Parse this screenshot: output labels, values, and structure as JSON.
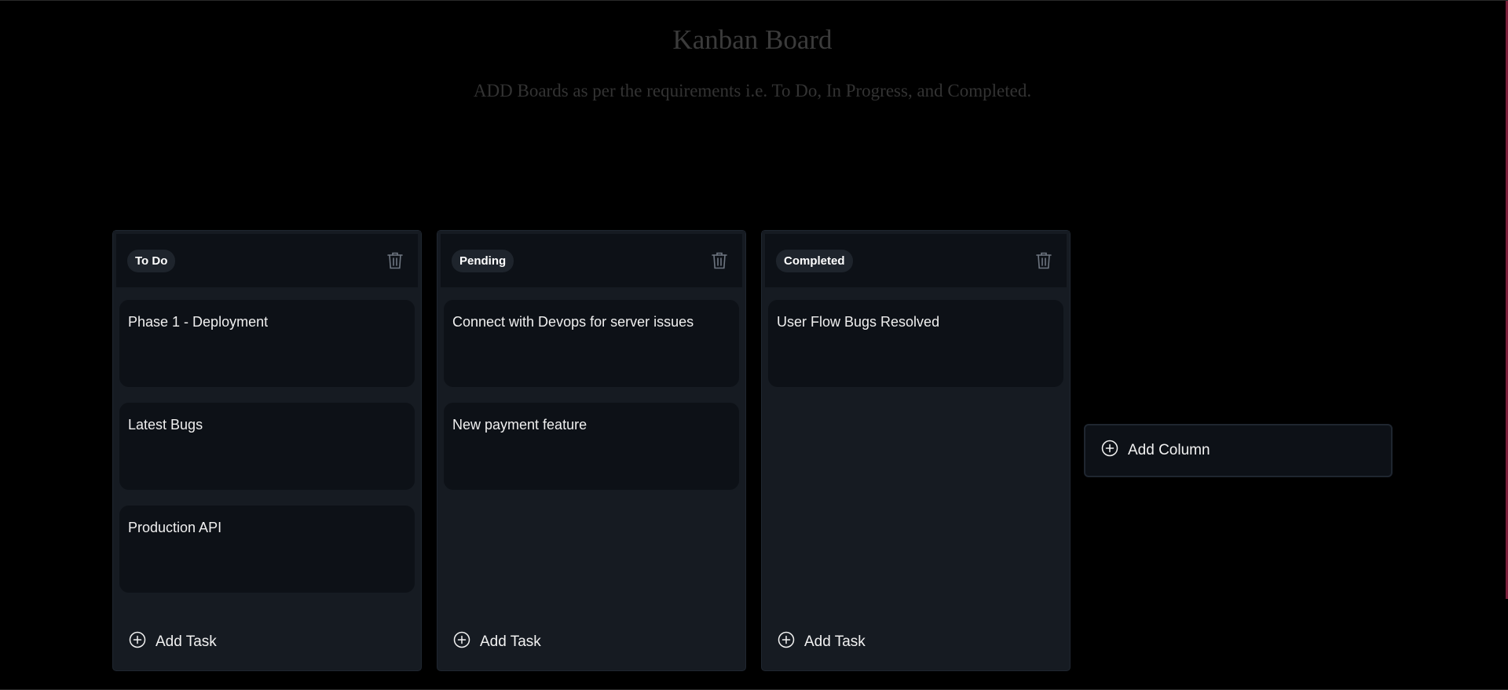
{
  "header": {
    "title": "Kanban Board",
    "subtitle": "ADD Boards as per the requirements i.e. To Do, In Progress, and Completed."
  },
  "columns": [
    {
      "title": "To Do",
      "tasks": [
        "Phase 1 - Deployment",
        "Latest Bugs",
        "Production API"
      ],
      "add_task_label": "Add Task"
    },
    {
      "title": "Pending",
      "tasks": [
        "Connect with Devops for server issues",
        "New payment feature"
      ],
      "add_task_label": "Add Task"
    },
    {
      "title": "Completed",
      "tasks": [
        "User Flow Bugs Resolved"
      ],
      "add_task_label": "Add Task"
    }
  ],
  "add_column_label": "Add Column",
  "icons": {
    "delete": "trash-icon",
    "add": "plus-circle-icon"
  },
  "colors": {
    "background": "#000000",
    "column_bg": "#161b22",
    "card_bg": "#0d1117",
    "title_text": "#3b3b3b",
    "accent_edge": "#7a1e3a"
  }
}
